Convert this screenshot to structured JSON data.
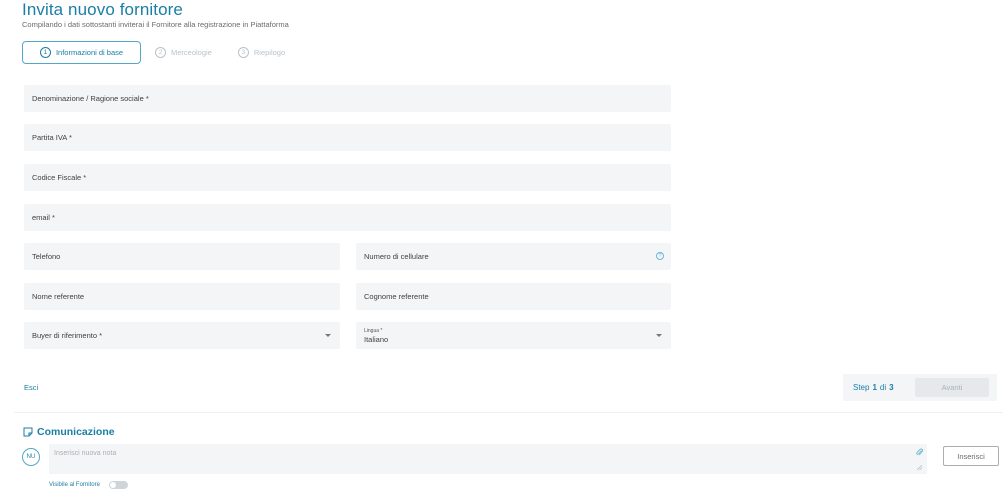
{
  "header": {
    "title": "Invita nuovo fornitore",
    "subtitle": "Compilando i dati sottostanti inviterai il Fornitore alla registrazione in Piattaforma"
  },
  "stepper": {
    "steps": [
      {
        "num": "1",
        "label": "Informazioni di base",
        "active": true
      },
      {
        "num": "2",
        "label": "Merceologie",
        "active": false
      },
      {
        "num": "3",
        "label": "Riepilogo",
        "active": false
      }
    ]
  },
  "form": {
    "denominazione": "Denominazione / Ragione sociale *",
    "partita_iva": "Partita IVA *",
    "codice_fiscale": "Codice Fiscale *",
    "email": "email *",
    "telefono": "Telefono",
    "cellulare": "Numero di cellulare",
    "nome_referente": "Nome referente",
    "cognome_referente": "Cognome referente",
    "buyer": "Buyer di riferimento *",
    "lingua_label": "Lingua *",
    "lingua_value": "Italiano"
  },
  "footer": {
    "esci": "Esci",
    "step_prefix": "Step",
    "step_current": "1",
    "step_sep": "di",
    "step_total": "3",
    "avanti": "Avanti"
  },
  "comunicazione": {
    "title": "Comunicazione",
    "avatar": "NU",
    "note_placeholder": "Inserisci nuova nota",
    "inserisci": "Inserisci",
    "visibile": "Visibile al Fornitore"
  },
  "colors": {
    "accent": "#1b7ea6",
    "field_bg": "#f3f5f7"
  }
}
